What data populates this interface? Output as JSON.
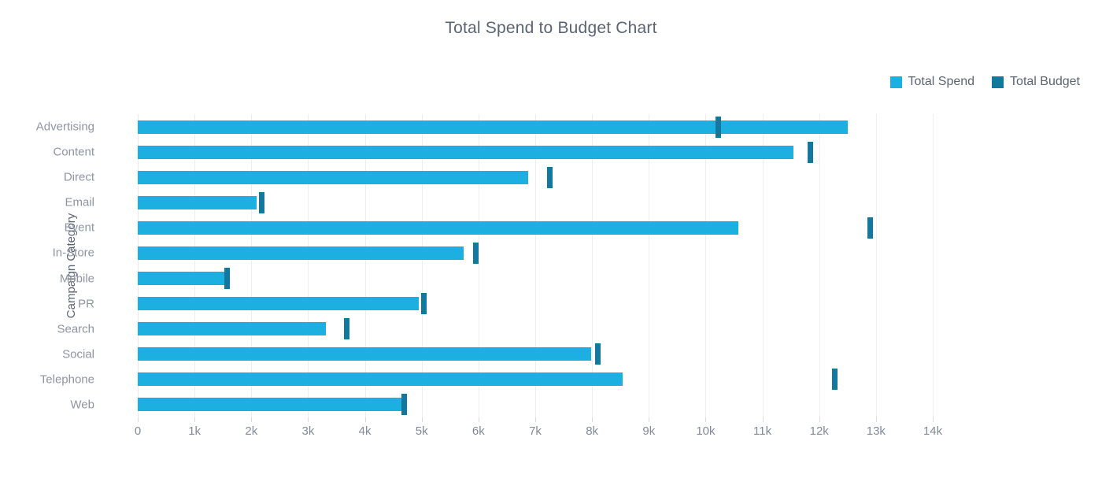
{
  "header": {
    "title": "Total Spend to Budget Chart"
  },
  "legend": {
    "position": "top-right",
    "items": [
      {
        "label": "Total Spend",
        "color": "#1cb0e0",
        "icon": "square-swatch-icon"
      },
      {
        "label": "Total Budget",
        "color": "#13789e",
        "icon": "square-swatch-icon"
      }
    ]
  },
  "axes": {
    "y_title": "Campaign Category",
    "x_title": "",
    "x_ticks": [
      "0",
      "1k",
      "2k",
      "3k",
      "4k",
      "5k",
      "6k",
      "7k",
      "8k",
      "9k",
      "10k",
      "11k",
      "12k",
      "13k",
      "14k"
    ]
  },
  "chart_data": {
    "type": "bar",
    "orientation": "horizontal",
    "title": "Total Spend to Budget Chart",
    "xlabel": "",
    "ylabel": "Campaign Category",
    "xlim": [
      0,
      14000
    ],
    "xtick_values": [
      0,
      1000,
      2000,
      3000,
      4000,
      5000,
      6000,
      7000,
      8000,
      9000,
      10000,
      11000,
      12000,
      13000,
      14000
    ],
    "xtick_labels": [
      "0",
      "1k",
      "2k",
      "3k",
      "4k",
      "5k",
      "6k",
      "7k",
      "8k",
      "9k",
      "10k",
      "11k",
      "12k",
      "13k",
      "14k"
    ],
    "grid": "vertical",
    "legend_position": "top-right",
    "categories": [
      "Advertising",
      "Content",
      "Direct",
      "Email",
      "Event",
      "In-Store",
      "Mobile",
      "PR",
      "Search",
      "Social",
      "Telephone",
      "Web"
    ],
    "series": [
      {
        "name": "Total Spend",
        "color": "#1cb0e0",
        "mark": "bar",
        "values": [
          12500,
          11550,
          6880,
          2090,
          10580,
          5740,
          1530,
          4950,
          3310,
          7980,
          8540,
          4640
        ]
      },
      {
        "name": "Total Budget",
        "color": "#13789e",
        "mark": "tick",
        "values": [
          10220,
          11840,
          7250,
          2190,
          12900,
          5950,
          1580,
          5040,
          3680,
          8100,
          12280,
          4690
        ]
      }
    ]
  }
}
